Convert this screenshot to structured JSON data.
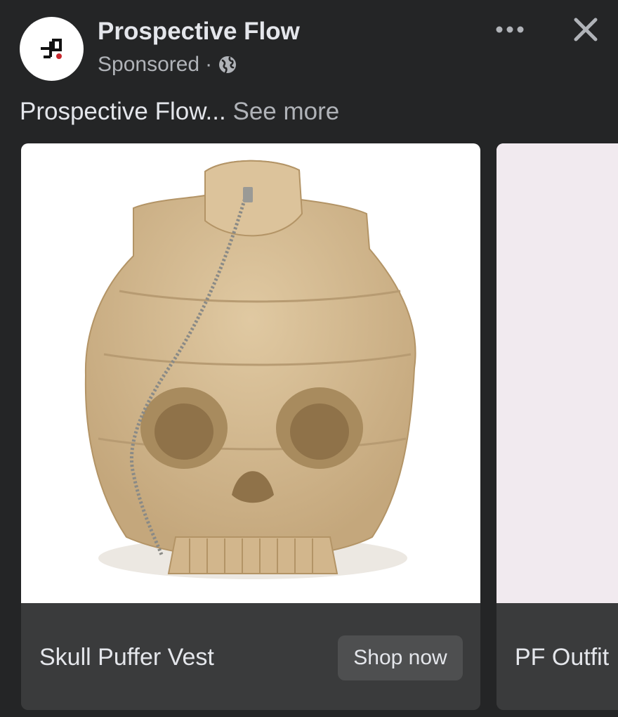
{
  "post": {
    "page_name": "Prospective Flow",
    "sponsored_label": "Sponsored",
    "separator": "·",
    "audience_icon": "globe-icon",
    "more_icon": "more-horizontal-icon",
    "close_icon": "close-icon",
    "caption_text": "Prospective Flow...",
    "see_more_label": "See more"
  },
  "avatar": {
    "logo_icon": "prospective-flow-logo",
    "logo_accent_color": "#c8282e"
  },
  "carousel": {
    "cards": [
      {
        "title": "Skull Puffer Vest",
        "cta_label": "Shop now",
        "image_icon": "skull-puffer-vest-image"
      },
      {
        "title": "PF Outfit",
        "image_icon": "pf-outfit-image"
      }
    ]
  },
  "colors": {
    "background": "#242526",
    "card_footer": "#3a3b3c",
    "button": "#4e4f50",
    "primary_text": "#e4e6eb",
    "secondary_text": "#b0b3b8",
    "vest_tan": "#d6bc94"
  }
}
